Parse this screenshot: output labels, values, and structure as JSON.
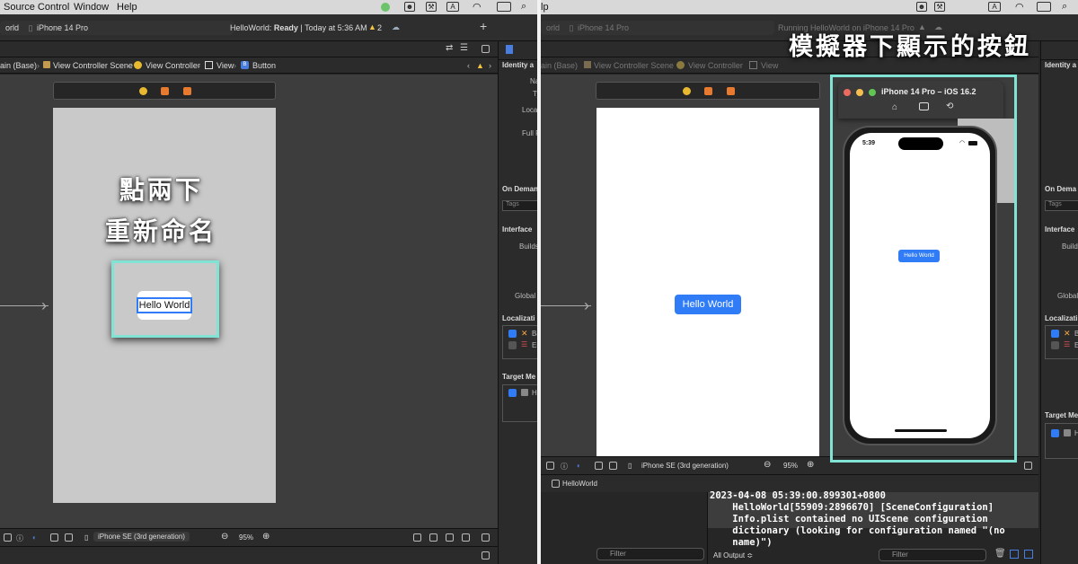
{
  "overlay_left": {
    "line1": "點兩下",
    "line2": "重新命名"
  },
  "overlay_right": {
    "title": "模擬器下顯示的按鈕"
  },
  "menubar": {
    "source_control": "Source Control",
    "window": "Window",
    "help": "Help",
    "cut_item": "lp"
  },
  "toolbar": {
    "scheme_left": "orld",
    "device": "iPhone 14 Pro",
    "status_app": "HelloWorld:",
    "status_state": "Ready",
    "status_time": "| Today at 5:36 AM",
    "warning_count": "2",
    "running": "Running HelloWorld on iPhone 14 Pro"
  },
  "breadcrumb": {
    "scheme": "ain (Base)",
    "scene": "View Controller Scene",
    "controller": "View Controller",
    "view": "View",
    "button": "Button"
  },
  "canvas": {
    "button_label": "Hello World",
    "right_button_label": "Hello World"
  },
  "device_bar": {
    "device": "iPhone SE (3rd generation)",
    "zoom": "95%"
  },
  "simulator": {
    "title": "iPhone 14 Pro – iOS 16.2",
    "time": "5:39",
    "button_label": "Hello World"
  },
  "inspector": {
    "identity": "Identity a",
    "name": "Na",
    "type": "Ty",
    "location": "Locat",
    "full_path": "Full P",
    "on_demand": "On Deman",
    "tags": "Tags",
    "interface": "Interface",
    "builds": "Builds",
    "global": "Global T",
    "localization": "Localizati",
    "loc1": "Ba",
    "loc2": "En",
    "target": "Target Me",
    "target1": "He",
    "right_identity": "Identity a",
    "right_on_demand": "On Dema",
    "right_interface": "Interface",
    "right_localization": "Localizati",
    "right_target": "Target Me"
  },
  "debug": {
    "target": "HelloWorld",
    "console": "2023-04-08 05:39:00.899301+0800\n    HelloWorld[55909:2896670] [SceneConfiguration]\n    Info.plist contained no UIScene configuration\n    dictionary (looking for configuration named \"(no\n    name)\")",
    "filter": "Filter",
    "all_output": "All Output ≎",
    "filter2": "Filter"
  },
  "colors": {
    "highlight": "#80e3d3",
    "ios_blue": "#2f7cf6"
  }
}
